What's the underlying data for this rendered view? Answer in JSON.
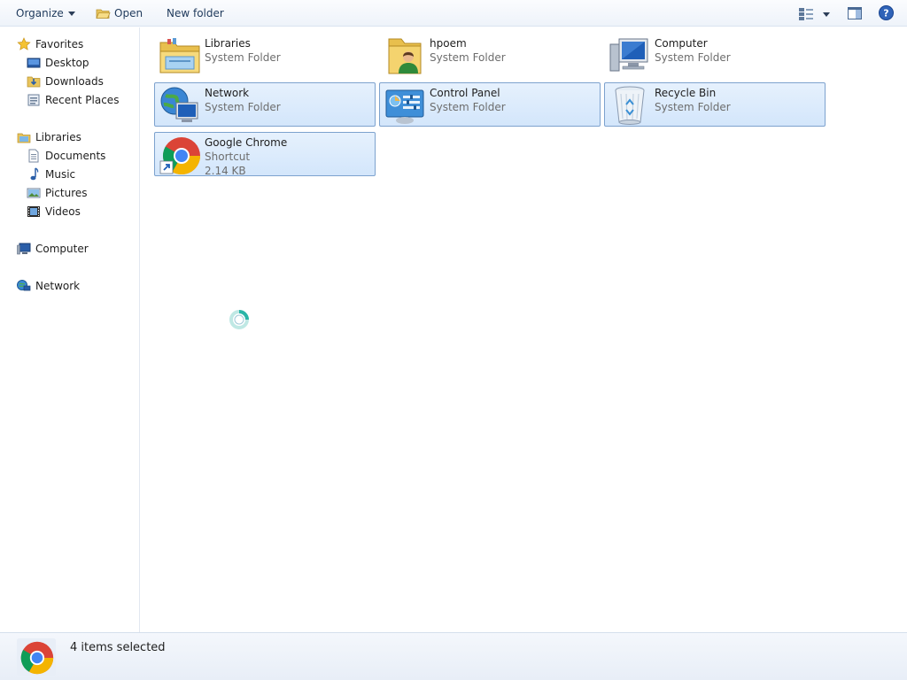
{
  "toolbar": {
    "organize_label": "Organize",
    "open_label": "Open",
    "new_folder_label": "New folder"
  },
  "nav": {
    "favorites": {
      "label": "Favorites",
      "items": [
        {
          "label": "Desktop"
        },
        {
          "label": "Downloads"
        },
        {
          "label": "Recent Places"
        }
      ]
    },
    "libraries": {
      "label": "Libraries",
      "items": [
        {
          "label": "Documents"
        },
        {
          "label": "Music"
        },
        {
          "label": "Pictures"
        },
        {
          "label": "Videos"
        }
      ]
    },
    "computer_label": "Computer",
    "network_label": "Network"
  },
  "items": [
    {
      "name": "Libraries",
      "type": "System Folder",
      "selected": false,
      "icon": "libraries-icon"
    },
    {
      "name": "hpoem",
      "type": "System Folder",
      "selected": false,
      "icon": "user-folder-icon"
    },
    {
      "name": "Computer",
      "type": "System Folder",
      "selected": false,
      "icon": "computer-icon"
    },
    {
      "name": "Network",
      "type": "System Folder",
      "selected": true,
      "icon": "network-icon"
    },
    {
      "name": "Control Panel",
      "type": "System Folder",
      "selected": true,
      "icon": "control-panel-icon"
    },
    {
      "name": "Recycle Bin",
      "type": "System Folder",
      "selected": true,
      "icon": "recycle-bin-icon"
    },
    {
      "name": "Google Chrome",
      "type": "Shortcut",
      "size": "2.14 KB",
      "selected": true,
      "icon": "chrome-icon"
    }
  ],
  "status": {
    "text": "4 items selected",
    "icon": "chrome-icon"
  },
  "colors": {
    "selection_fill": "#d9e8fb",
    "selection_border": "#7da2ce",
    "toolbar_text": "#1e395b",
    "secondary_text": "#6d6d6d"
  }
}
